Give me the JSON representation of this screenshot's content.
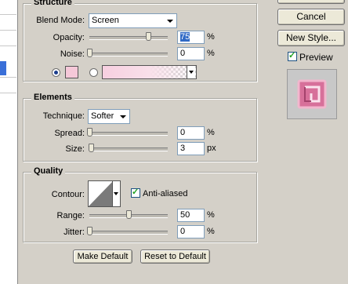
{
  "structure": {
    "title": "Structure",
    "blend_mode_label": "Blend Mode:",
    "blend_mode_value": "Screen",
    "opacity_label": "Opacity:",
    "opacity_value": "75",
    "opacity_unit": "%",
    "opacity_level": 0.75,
    "noise_label": "Noise:",
    "noise_value": "0",
    "noise_unit": "%",
    "noise_level": 0,
    "color_swatch": "#f5c8d8"
  },
  "elements": {
    "title": "Elements",
    "technique_label": "Technique:",
    "technique_value": "Softer",
    "spread_label": "Spread:",
    "spread_value": "0",
    "spread_unit": "%",
    "spread_level": 0,
    "size_label": "Size:",
    "size_value": "3",
    "size_unit": "px",
    "size_level": 0.02
  },
  "quality": {
    "title": "Quality",
    "contour_label": "Contour:",
    "anti_aliased_label": "Anti-aliased",
    "anti_aliased_checked": true,
    "range_label": "Range:",
    "range_value": "50",
    "range_unit": "%",
    "range_level": 0.5,
    "jitter_label": "Jitter:",
    "jitter_value": "0",
    "jitter_unit": "%",
    "jitter_level": 0
  },
  "buttons": {
    "make_default": "Make Default",
    "reset_default": "Reset to Default",
    "cancel": "Cancel",
    "new_style": "New Style...",
    "preview_label": "Preview",
    "preview_checked": true
  },
  "colors": {
    "panel_bg": "#d4d0c8",
    "preview_pink": "#d7709a"
  }
}
